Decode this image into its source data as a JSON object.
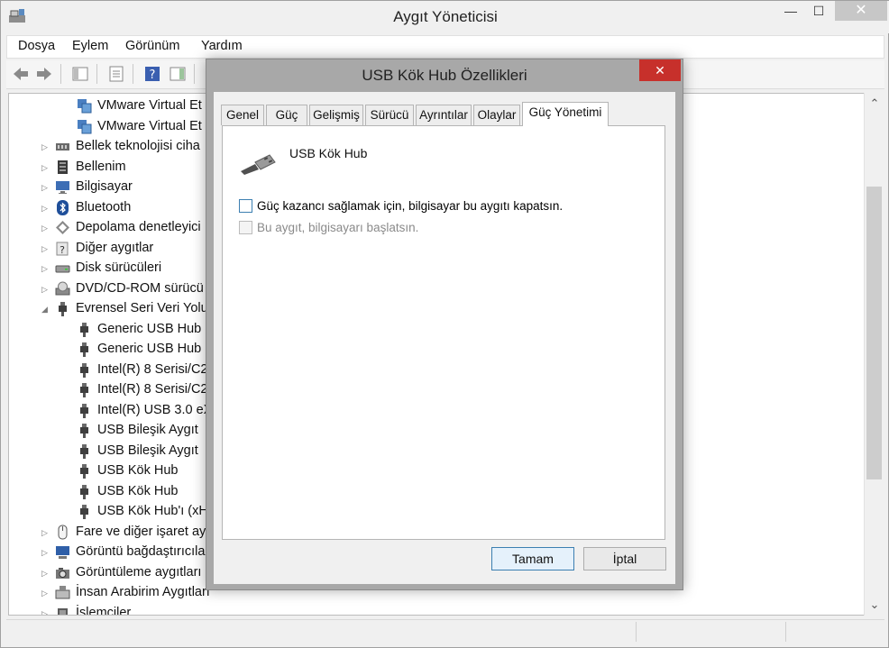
{
  "window": {
    "title": "Aygıt Yöneticisi",
    "min_glyph": "—",
    "max_glyph": "☐",
    "close_glyph": "✕"
  },
  "menu": [
    "Dosya",
    "Eylem",
    "Görünüm",
    "Yardım"
  ],
  "tree": {
    "items": [
      {
        "label": "VMware Virtual Et",
        "level": 2,
        "icon": "network-adapter-icon",
        "expander": ""
      },
      {
        "label": "VMware Virtual Et",
        "level": 2,
        "icon": "network-adapter-icon",
        "expander": ""
      },
      {
        "label": "Bellek teknolojisi ciha",
        "level": 1,
        "icon": "memory-icon",
        "expander": "▷"
      },
      {
        "label": "Bellenim",
        "level": 1,
        "icon": "firmware-icon",
        "expander": "▷"
      },
      {
        "label": "Bilgisayar",
        "level": 1,
        "icon": "computer-icon",
        "expander": "▷"
      },
      {
        "label": "Bluetooth",
        "level": 1,
        "icon": "bluetooth-icon",
        "expander": "▷"
      },
      {
        "label": "Depolama denetleyici",
        "level": 1,
        "icon": "storage-controller-icon",
        "expander": "▷"
      },
      {
        "label": "Diğer aygıtlar",
        "level": 1,
        "icon": "unknown-device-icon",
        "expander": "▷"
      },
      {
        "label": "Disk sürücüleri",
        "level": 1,
        "icon": "disk-drive-icon",
        "expander": "▷"
      },
      {
        "label": "DVD/CD-ROM sürücü",
        "level": 1,
        "icon": "dvd-drive-icon",
        "expander": "▷"
      },
      {
        "label": "Evrensel Seri Veri Yolu",
        "level": 1,
        "icon": "usb-icon",
        "expander": "◢"
      },
      {
        "label": "Generic USB Hub",
        "level": 2,
        "icon": "usb-icon",
        "expander": ""
      },
      {
        "label": "Generic USB Hub",
        "level": 2,
        "icon": "usb-icon",
        "expander": ""
      },
      {
        "label": "Intel(R) 8 Serisi/C2",
        "level": 2,
        "icon": "usb-icon",
        "expander": ""
      },
      {
        "label": "Intel(R) 8 Serisi/C2",
        "level": 2,
        "icon": "usb-icon",
        "expander": ""
      },
      {
        "label": "Intel(R) USB 3.0 eX",
        "level": 2,
        "icon": "usb-icon",
        "expander": ""
      },
      {
        "label": "USB Bileşik Aygıt",
        "level": 2,
        "icon": "usb-icon",
        "expander": ""
      },
      {
        "label": "USB Bileşik Aygıt",
        "level": 2,
        "icon": "usb-icon",
        "expander": ""
      },
      {
        "label": "USB Kök Hub",
        "level": 2,
        "icon": "usb-icon",
        "expander": ""
      },
      {
        "label": "USB Kök Hub",
        "level": 2,
        "icon": "usb-icon",
        "expander": ""
      },
      {
        "label": "USB Kök Hub'ı (xH",
        "level": 2,
        "icon": "usb-icon",
        "expander": ""
      },
      {
        "label": "Fare ve diğer işaret ay",
        "level": 1,
        "icon": "mouse-icon",
        "expander": "▷"
      },
      {
        "label": "Görüntü bağdaştırıcıla",
        "level": 1,
        "icon": "display-adapter-icon",
        "expander": "▷"
      },
      {
        "label": "Görüntüleme aygıtları",
        "level": 1,
        "icon": "imaging-device-icon",
        "expander": "▷"
      },
      {
        "label": "İnsan Arabirim Aygıtları",
        "level": 1,
        "icon": "hid-icon",
        "expander": "▷"
      },
      {
        "label": "İşlemciler",
        "level": 1,
        "icon": "processor-icon",
        "expander": "▷"
      }
    ]
  },
  "dialog": {
    "title": "USB Kök Hub Özellikleri",
    "close_glyph": "✕",
    "tabs": [
      "Genel",
      "Güç",
      "Gelişmiş",
      "Sürücü",
      "Ayrıntılar",
      "Olaylar",
      "Güç Yönetimi"
    ],
    "active_tab": "Güç Yönetimi",
    "device_name": "USB Kök Hub",
    "options": [
      {
        "label": "Güç kazancı sağlamak için, bilgisayar bu aygıtı kapatsın.",
        "checked": false,
        "enabled": true
      },
      {
        "label": "Bu aygıt, bilgisayarı başlatsın.",
        "checked": false,
        "enabled": false
      }
    ],
    "ok_label": "Tamam",
    "cancel_label": "İptal"
  },
  "colors": {
    "close_red": "#c7302b",
    "focus_blue": "#3c7fb1",
    "disabled_text": "#8a8a8a"
  }
}
